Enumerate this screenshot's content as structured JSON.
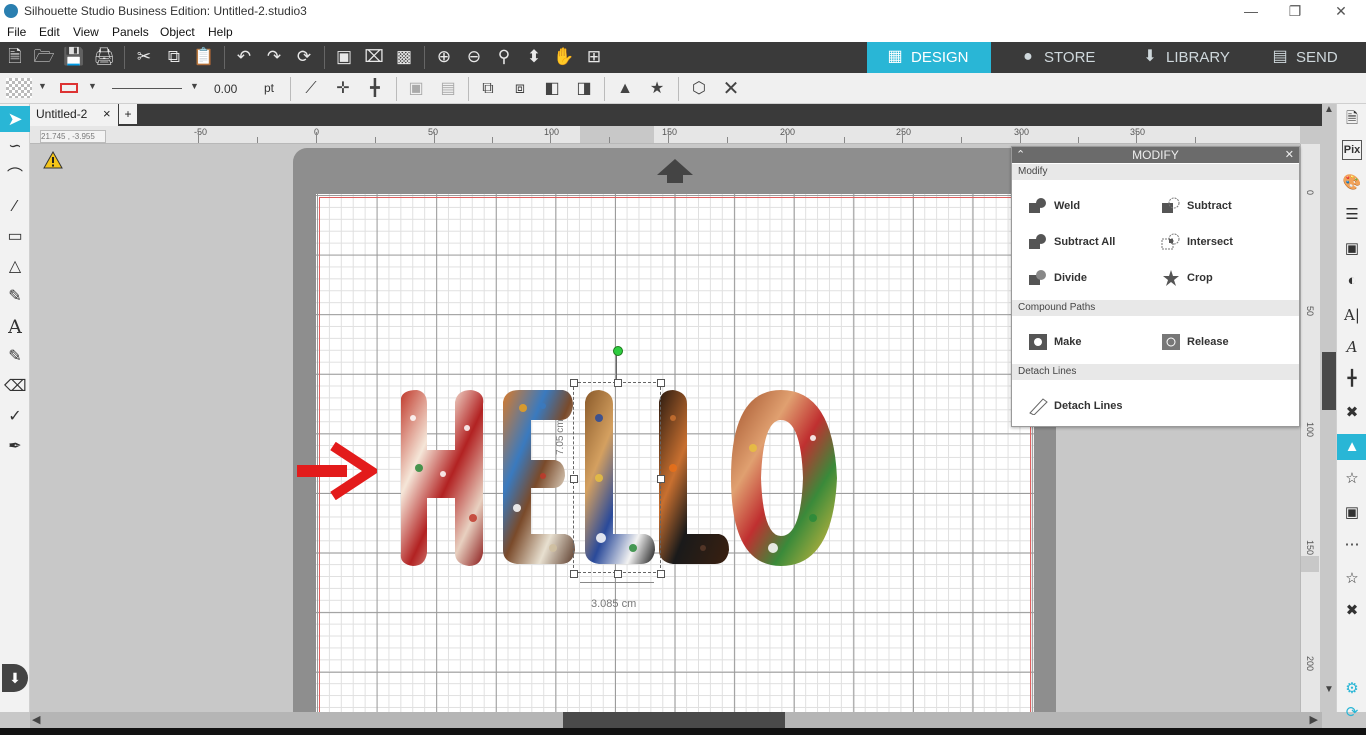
{
  "window": {
    "title": "Silhouette Studio Business Edition: Untitled-2.studio3"
  },
  "menu": [
    "File",
    "Edit",
    "View",
    "Panels",
    "Object",
    "Help"
  ],
  "nav_tabs": [
    {
      "label": "DESIGN",
      "icon": "grid-icon",
      "active": true
    },
    {
      "label": "STORE",
      "icon": "silhouette-s-icon",
      "active": false
    },
    {
      "label": "LIBRARY",
      "icon": "library-download-icon",
      "active": false
    },
    {
      "label": "SEND",
      "icon": "cutter-icon",
      "active": false
    }
  ],
  "line_toolbar": {
    "line_width": "0.00",
    "unit": "pt"
  },
  "document_tab": {
    "name": "Untitled-2",
    "close": "×",
    "add": "+"
  },
  "coordinates": "21.745 , -3.955",
  "ruler": {
    "horizontal": [
      "-50",
      "0",
      "50",
      "100",
      "150",
      "200",
      "250",
      "300",
      "350"
    ],
    "vertical": [
      "0",
      "50",
      "100",
      "150",
      "200"
    ]
  },
  "canvas": {
    "text_object": "HELLO",
    "dimension_label": "3.085 cm",
    "vertical_dimension_label": "7.05 cm",
    "arrow_color": "#e31b1b"
  },
  "modify_panel": {
    "title": "MODIFY",
    "sections": [
      {
        "title": "Modify",
        "buttons": [
          "Weld",
          "Subtract",
          "Subtract All",
          "Intersect",
          "Divide",
          "Crop"
        ]
      },
      {
        "title": "Compound Paths",
        "buttons": [
          "Make",
          "Release"
        ]
      },
      {
        "title": "Detach Lines",
        "buttons": [
          "Detach Lines"
        ]
      }
    ]
  },
  "right_panel_icons": [
    "page-setup-icon",
    "pix-scan-icon",
    "fill-color-icon",
    "line-style-icon",
    "print-cut-icon",
    "transparency-icon",
    "text-style-icon",
    "text-font-icon",
    "align-icon",
    "replicate-icon",
    "modify-icon",
    "offset-icon",
    "trace-icon",
    "rhinestone-icon",
    "star-icon",
    "puzzle-icon",
    "settings-gear-icon",
    "refresh-icon"
  ],
  "right_panel_labels": {
    "pix": "Pix"
  },
  "colors": {
    "accent": "#29b6d6",
    "toolbar_dark": "#3a3a3a",
    "mat": "#8e8e8e",
    "warning": "#f5c518"
  }
}
